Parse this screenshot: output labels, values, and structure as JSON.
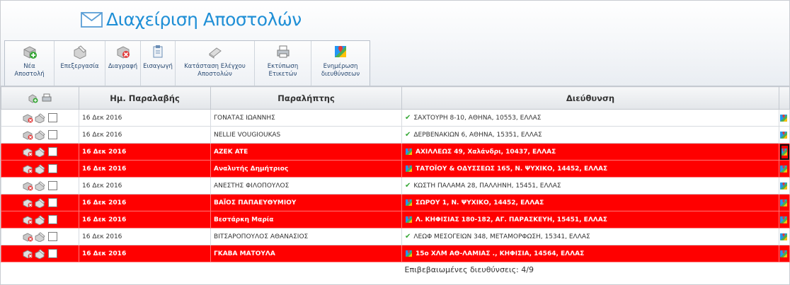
{
  "page": {
    "title": "Διαχείριση Αποστολών"
  },
  "toolbar": [
    {
      "name": "new-shipment-button",
      "icon": "new-shipment-icon",
      "label1": "Νέα",
      "label2": "Αποστολή"
    },
    {
      "name": "edit-button",
      "icon": "edit-icon",
      "label1": "Επεξεργασία",
      "label2": ""
    },
    {
      "name": "delete-button",
      "icon": "delete-icon",
      "label1": "Διαγραφή",
      "label2": ""
    },
    {
      "name": "import-button",
      "icon": "import-icon",
      "label1": "Εισαγωγή",
      "label2": ""
    },
    {
      "name": "shipment-check-status-button",
      "icon": "check-status-icon",
      "label1": "Κατάσταση Ελέγχου",
      "label2": "Αποστολών"
    },
    {
      "name": "print-labels-button",
      "icon": "printer-icon",
      "label1": "Εκτύπωση",
      "label2": "Ετικετών"
    },
    {
      "name": "update-addresses-button",
      "icon": "map-icon",
      "label1": "Ενημέρωση",
      "label2": "διευθύνσεων"
    }
  ],
  "table": {
    "columns": [
      "",
      "Ημ. Παραλαβής",
      "Παραλήπτης",
      "Διεύθυνση",
      ""
    ],
    "rows": [
      {
        "status": "ok",
        "date": "16 Δεκ 2016",
        "recipient": "ΓΟΝΑΤΑΣ ΙΩΑΝΝΗΣ",
        "address": "ΣΑΧΤΟΥΡΗ 8-10, ΑΘΗΝΑ, 10553, ΕΛΛΑΣ"
      },
      {
        "status": "ok",
        "date": "16 Δεκ 2016",
        "recipient": "NELLIE VOUGIOUKAS",
        "address": "ΔΕΡΒΕΝΑΚΙΩΝ 6, ΑΘΗΝΑ, 15351, ΕΛΛΑΣ"
      },
      {
        "status": "warn",
        "date": "16 Δεκ 2016",
        "recipient": "AZEK ATE",
        "address": "ΑΧΙΛΛΕΩΣ 49, Χαλάνδρι, 10437, ΕΛΛΑΣ"
      },
      {
        "status": "warn",
        "date": "16 Δεκ 2016",
        "recipient": "Αναλυτής Δημήτριος",
        "address": "ΤΑΤΟΪΟΥ & ΟΔΥΣΣΕΩΣ 165, Ν. ΨΥΧΙΚΟ, 14452, ΕΛΛΑΣ"
      },
      {
        "status": "ok",
        "date": "16 Δεκ 2016",
        "recipient": "ΑΝΕΣΤΗΣ ΦΙΛΟΠΟΥΛΟΣ",
        "address": "ΚΩΣΤΗ ΠΑΛΑΜΑ 28, ΠΑΛΛΗΝΗ, 15451, ΕΛΛΑΣ"
      },
      {
        "status": "warn",
        "date": "16 Δεκ 2016",
        "recipient": "ΒΑΪΟΣ ΠΑΠΑΕΥΘΥΜΙΟΥ",
        "address": "ΣΩΡΟΥ 1, Ν. ΨΥΧΙΚΟ, 14452, ΕΛΛΑΣ"
      },
      {
        "status": "warn",
        "date": "16 Δεκ 2016",
        "recipient": "Βεστάρκη Μαρία",
        "address": "Λ. ΚΗΦΙΣΙΑΣ 180-182, ΑΓ. ΠΑΡΑΣΚΕΥΗ, 15451, ΕΛΛΑΣ"
      },
      {
        "status": "ok",
        "date": "16 Δεκ 2016",
        "recipient": "ΒΙΤΣΑΡΟΠΟΥΛΟΣ ΑΘΑΝΑΣΙΟΣ",
        "address": "ΛΕΩΦ ΜΕΣΟΓΕΙΩΝ 348, ΜΕΤΑΜΟΡΦΩΣΗ, 15341, ΕΛΛΑΣ"
      },
      {
        "status": "warn",
        "date": "16 Δεκ 2016",
        "recipient": "ΓΚΑΒΑ ΜΑΤΟΥΛΑ",
        "address": "15ο ΧΛΜ ΑΘ-ΛΑΜΙΑΣ ., ΚΗΦΙΣΙΑ, 14564, ΕΛΛΑΣ"
      }
    ],
    "footer": "Επιβεβαιωμένες διευθύνσεις: 4/9"
  },
  "colors": {
    "warn_row": "#ff0000",
    "title": "#1f8fd6",
    "check": "#35a835"
  }
}
